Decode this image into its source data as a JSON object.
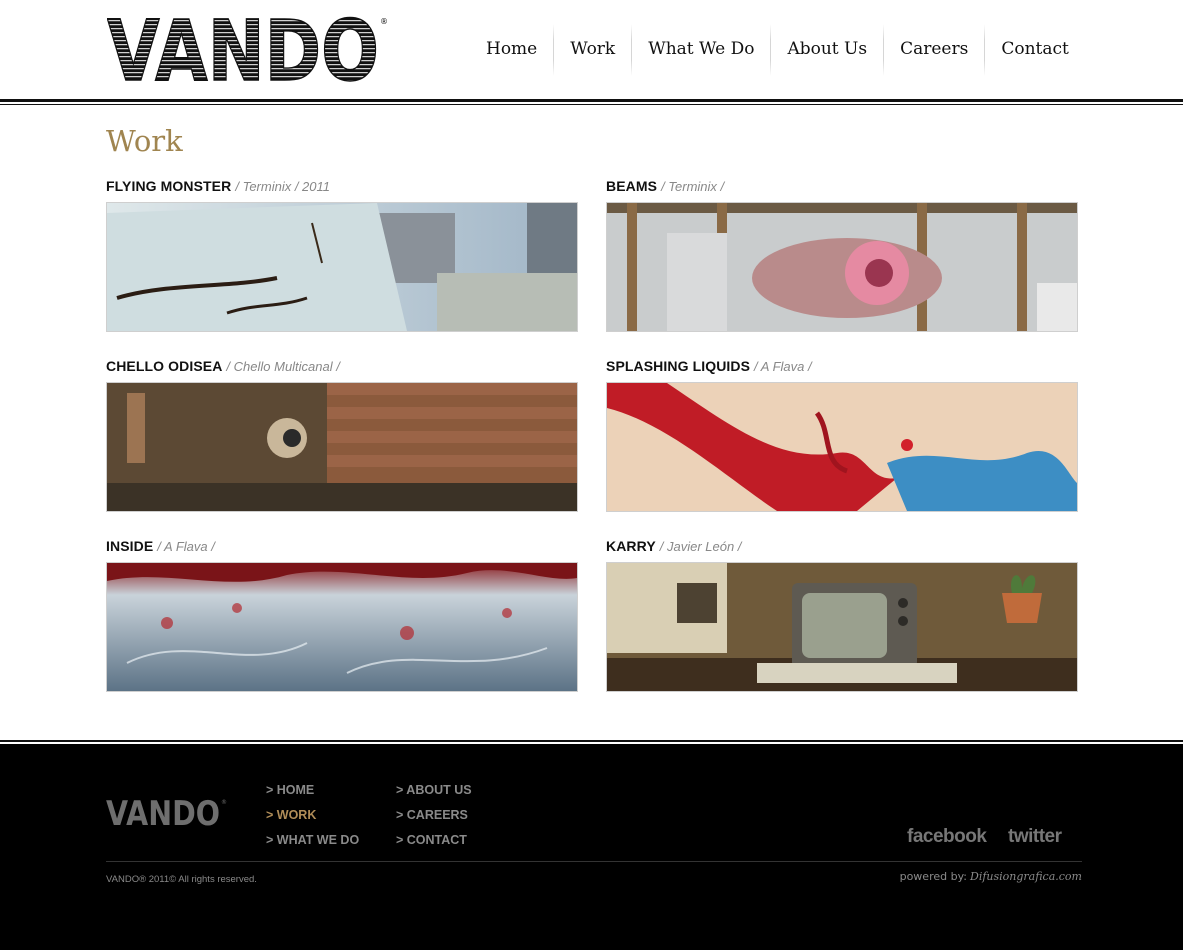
{
  "header": {
    "logo_text": "VANDO",
    "nav": [
      {
        "label": "Home"
      },
      {
        "label": "Work"
      },
      {
        "label": "What We Do"
      },
      {
        "label": "About Us"
      },
      {
        "label": "Careers"
      },
      {
        "label": "Contact"
      }
    ]
  },
  "main": {
    "title": "Work",
    "works": [
      {
        "title": "FLYING MONSTER",
        "client": "/ Terminix / 2011"
      },
      {
        "title": "BEAMS",
        "client": "/ Terminix /"
      },
      {
        "title": "CHELLO ODISEA",
        "client": "/ Chello Multicanal /"
      },
      {
        "title": "SPLASHING LIQUIDS",
        "client": "/ A Flava /"
      },
      {
        "title": "INSIDE",
        "client": "/ A Flava /"
      },
      {
        "title": "KARRY",
        "client": "/ Javier León /"
      }
    ]
  },
  "footer": {
    "logo_text": "VANDO",
    "links_col1": [
      {
        "label": "> HOME"
      },
      {
        "label": "> WORK"
      },
      {
        "label": "> WHAT WE DO"
      }
    ],
    "links_col2": [
      {
        "label": "> ABOUT US"
      },
      {
        "label": "> CAREERS"
      },
      {
        "label": "> CONTACT"
      }
    ],
    "social": {
      "facebook": "facebook",
      "twitter": "twitter"
    },
    "copyright": "VANDO® 2011© All rights reserved.",
    "powered_label": "powered by:",
    "powered_brand": "Difusiongrafica.com"
  },
  "colors": {
    "accent": "#a08550",
    "footer_active": "#b08d58",
    "footer_bg": "#000000"
  }
}
